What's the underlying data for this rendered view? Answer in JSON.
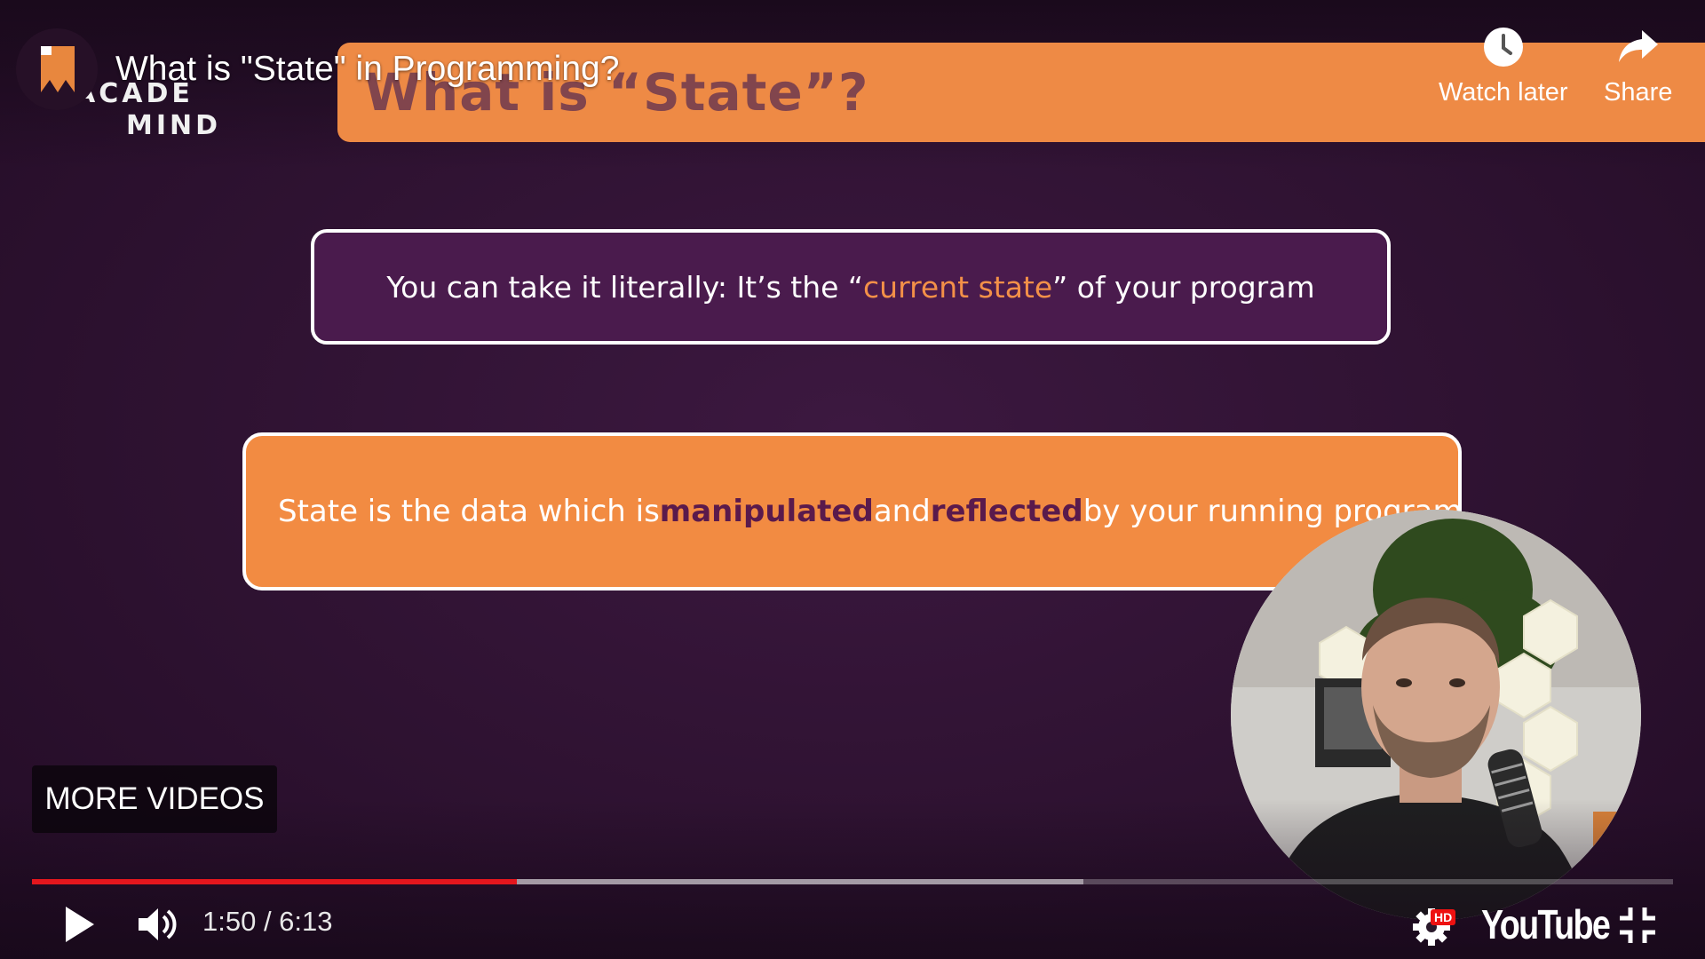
{
  "player": {
    "video_title": "What is \"State\" in Programming?",
    "watch_later_label": "Watch later",
    "share_label": "Share",
    "more_videos_label": "MORE VIDEOS",
    "time_display": "1:50 / 6:13",
    "progress_played_fraction": 0.2956,
    "progress_buffered_fraction": 0.6405,
    "quality_badge": "HD",
    "brand_logo_text": "YouTube",
    "icons": {
      "play": "play-icon",
      "volume": "volume-icon",
      "settings": "gear-icon",
      "exit_fullscreen": "exit-fullscreen-icon",
      "watch_later": "clock-icon",
      "share": "share-arrow-icon"
    },
    "colors": {
      "progress_played": "#e4161d",
      "slide_accent": "#ee8a45",
      "slide_background": "#2e1231"
    }
  },
  "channel": {
    "logo_line_1": "ACADE",
    "logo_line_2": "MIND"
  },
  "slide": {
    "heading": "What is “State”?",
    "box1": {
      "before": "You can take it literally: It’s the “",
      "highlight": "current state",
      "after": "” of your program"
    },
    "box2": {
      "part1": "State is the data which is ",
      "em1": "manipulated",
      "part2": " and ",
      "em2": "reflected",
      "part3": " by your running program"
    }
  }
}
